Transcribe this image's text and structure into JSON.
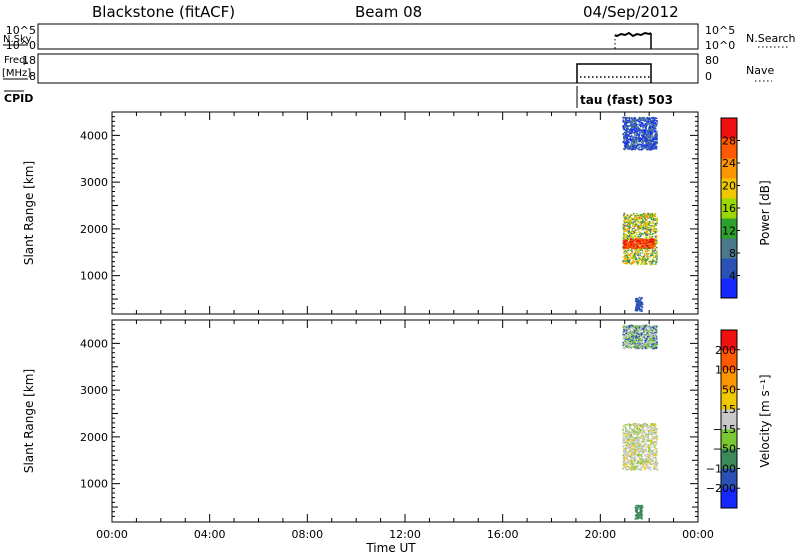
{
  "header": {
    "station": "Blackstone (fitACF)",
    "beam": "Beam 08",
    "date": "04/Sep/2012"
  },
  "noise_panel": {
    "left_label": "N.Sky",
    "left_ticks": [
      "10^5",
      "10^0"
    ],
    "right_ticks": [
      "10^5",
      "10^0"
    ],
    "right_label": "N.Search"
  },
  "freq_panel": {
    "left_label_1": "Freq.",
    "left_label_2": "[MHz]",
    "left_ticks": [
      "18",
      "8"
    ],
    "right_ticks": [
      "80",
      "0"
    ],
    "right_label": "Nave"
  },
  "cpid": {
    "label": "CPID",
    "program": "tau (fast) 503"
  },
  "x_axis": {
    "title": "Time UT",
    "ticks": [
      "00:00",
      "04:00",
      "08:00",
      "12:00",
      "16:00",
      "20:00",
      "00:00"
    ],
    "tick_hours": [
      0,
      4,
      8,
      12,
      16,
      20,
      24
    ]
  },
  "chart_data": [
    {
      "type": "heatmap",
      "name": "power",
      "ylabel": "Slant Range [km]",
      "yticks": [
        "4000",
        "3000",
        "2000",
        "1000"
      ],
      "ytick_values": [
        4000,
        3000,
        2000,
        1000
      ],
      "ylim": [
        180,
        4500
      ],
      "xlim_hours": [
        0,
        24
      ],
      "colorbar_label": "Power [dB]",
      "colorbar_ticks": [
        "28",
        "24",
        "20",
        "16",
        "12",
        "8",
        "4"
      ],
      "colorbar_values": [
        28,
        24,
        20,
        16,
        12,
        8,
        4
      ],
      "colorbar_range": [
        0,
        32
      ],
      "colorbar_colors": [
        "#1428ff",
        "#2a52b4",
        "#4a7a8a",
        "#2ea02e",
        "#9ad800",
        "#f0c800",
        "#ff9600",
        "#ff5a00",
        "#f01010"
      ],
      "regions": [
        {
          "t_start": 20.9,
          "t_end": 22.3,
          "r_min": 3700,
          "r_max": 4400,
          "dominant": [
            "#2a52b4",
            "#1428ff",
            "#4a7a8a"
          ]
        },
        {
          "t_start": 20.9,
          "t_end": 22.3,
          "r_min": 1250,
          "r_max": 2350,
          "dominant": [
            "#f0c800",
            "#2ea02e",
            "#ff9600",
            "#4a7a8a",
            "#9ad800"
          ]
        },
        {
          "t_start": 20.9,
          "t_end": 22.2,
          "r_min": 1600,
          "r_max": 1800,
          "dominant": [
            "#f01010",
            "#ff5a00"
          ]
        },
        {
          "t_start": 21.4,
          "t_end": 21.7,
          "r_min": 250,
          "r_max": 550,
          "dominant": [
            "#2a52b4"
          ]
        }
      ]
    },
    {
      "type": "heatmap",
      "name": "velocity",
      "ylabel": "Slant Range [km]",
      "yticks": [
        "4000",
        "3000",
        "2000",
        "1000"
      ],
      "ytick_values": [
        4000,
        3000,
        2000,
        1000
      ],
      "ylim": [
        180,
        4500
      ],
      "xlim_hours": [
        0,
        24
      ],
      "colorbar_label": "Velocity [m s⁻¹]",
      "colorbar_ticks": [
        "200",
        "100",
        "50",
        "15",
        "−15",
        "−50",
        "−100",
        "−200"
      ],
      "colorbar_colors": [
        "#1428ff",
        "#2a52b4",
        "#3a8a5a",
        "#7ac832",
        "#c8c8c8",
        "#f0c800",
        "#ff9600",
        "#ff5a00",
        "#f01010"
      ],
      "regions": [
        {
          "t_start": 20.9,
          "t_end": 22.3,
          "r_min": 3900,
          "r_max": 4400,
          "dominant": [
            "#c8c8c8",
            "#2a52b4",
            "#7ac832"
          ]
        },
        {
          "t_start": 20.9,
          "t_end": 22.3,
          "r_min": 1300,
          "r_max": 2300,
          "dominant": [
            "#c8c8c8",
            "#c8c8c8",
            "#c8c8c8",
            "#f0c800",
            "#7ac832"
          ]
        },
        {
          "t_start": 21.4,
          "t_end": 21.7,
          "r_min": 250,
          "r_max": 550,
          "dominant": [
            "#3a8a5a"
          ]
        }
      ]
    }
  ]
}
